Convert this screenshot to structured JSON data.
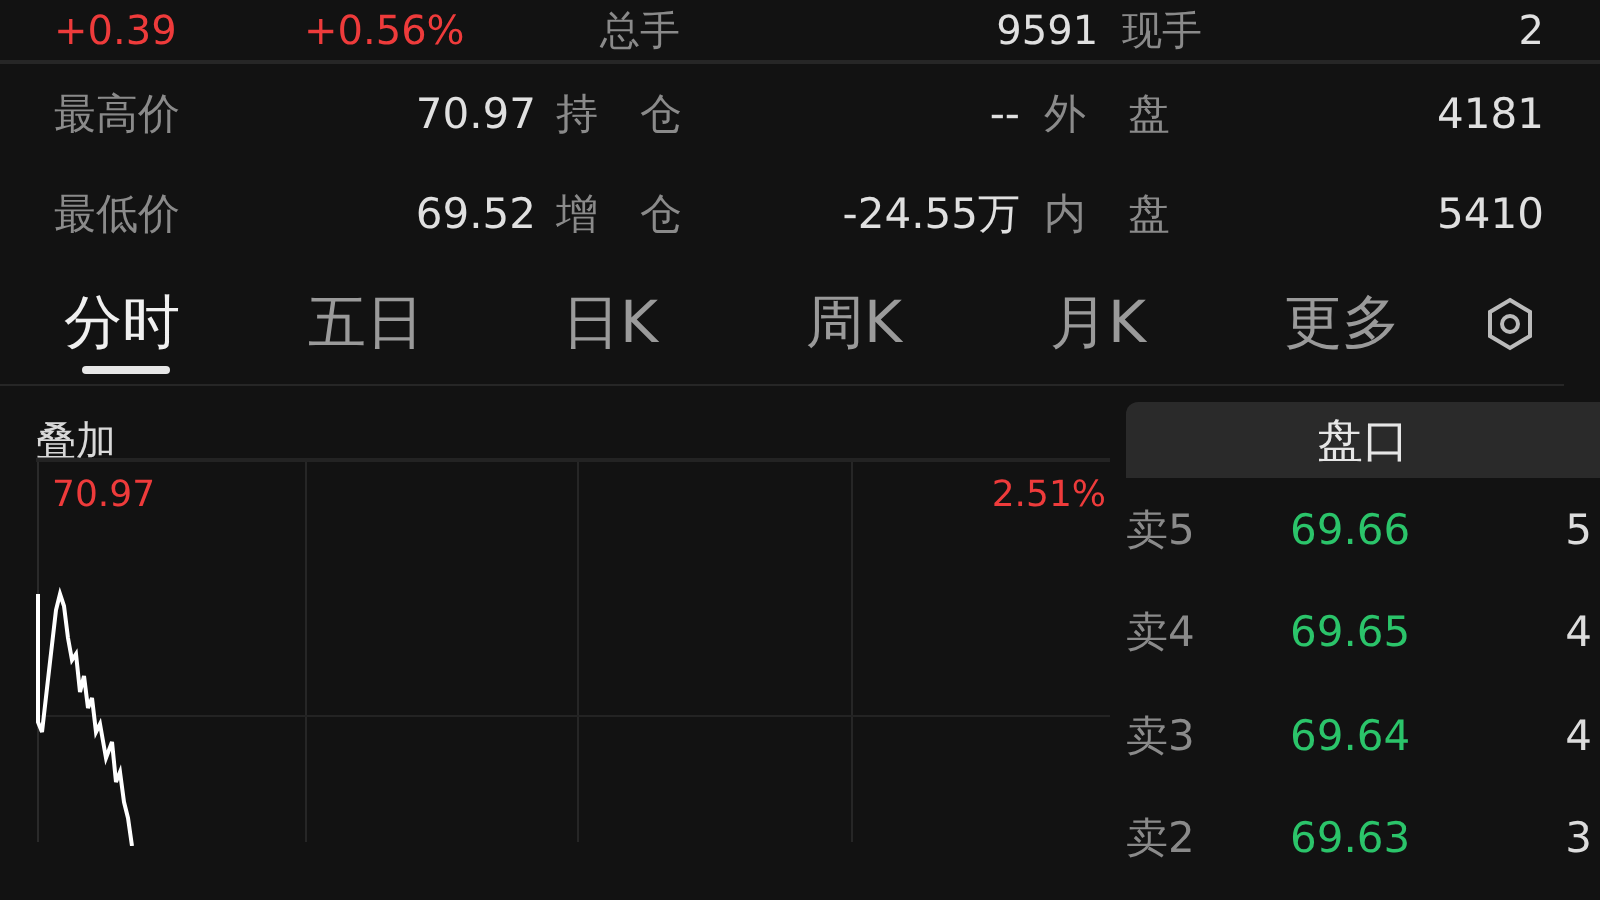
{
  "quote_summary": {
    "change": "+0.39",
    "change_percent": "+0.56%",
    "volume_label": "总手",
    "volume": "9591",
    "last_volume_label": "现手",
    "last_volume": "2"
  },
  "stats": [
    {
      "label": "最高价",
      "value": "70.97",
      "label2": "持　仓",
      "value2": "--",
      "label3": "外　盘",
      "value3": "4181"
    },
    {
      "label": "最低价",
      "value": "69.52",
      "label2": "增　仓",
      "value2": "-24.55万",
      "label3": "内　盘",
      "value3": "5410"
    }
  ],
  "tabs": [
    {
      "label": "分时",
      "selected": true
    },
    {
      "label": "五日",
      "selected": false
    },
    {
      "label": "日K",
      "selected": false
    },
    {
      "label": "周K",
      "selected": false
    },
    {
      "label": "月K",
      "selected": false
    },
    {
      "label": "更多",
      "selected": false
    }
  ],
  "overlay_label": "叠加",
  "chart": {
    "high_price": "70.97",
    "high_percent": "2.51%"
  },
  "order_book": {
    "title": "盘口",
    "rows": [
      {
        "side": "卖5",
        "price": "69.66",
        "volume": "5"
      },
      {
        "side": "卖4",
        "price": "69.65",
        "volume": "4"
      },
      {
        "side": "卖3",
        "price": "69.64",
        "volume": "4"
      },
      {
        "side": "卖2",
        "price": "69.63",
        "volume": "3"
      }
    ]
  }
}
